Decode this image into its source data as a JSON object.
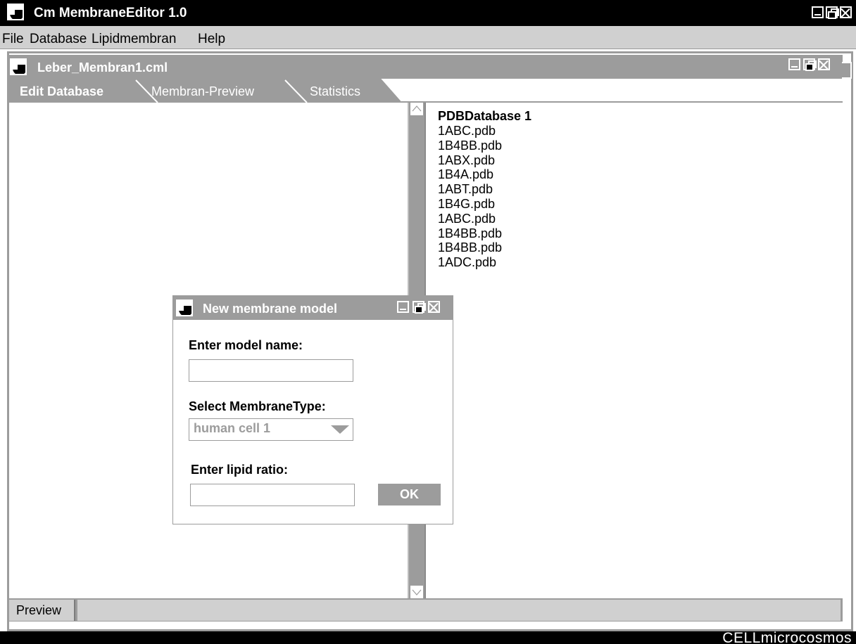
{
  "window": {
    "title": "Cm MembraneEditor 1.0"
  },
  "menu": {
    "items": [
      "File",
      "Database",
      "Lipidmembran",
      "Help"
    ]
  },
  "document": {
    "title": "Leber_Membran1.cml",
    "tabs": [
      {
        "label": "Edit Database",
        "active": true
      },
      {
        "label": "Membran-Preview",
        "active": false
      },
      {
        "label": "Statistics",
        "active": false
      }
    ]
  },
  "database": {
    "title": "PDBDatabase 1",
    "files": [
      "1ABC.pdb",
      "1B4BB.pdb",
      "1ABX.pdb",
      "1B4A.pdb",
      "1ABT.pdb",
      "1B4G.pdb",
      "1ABC.pdb",
      "1B4BB.pdb",
      "1B4BB.pdb",
      "1ADC.pdb"
    ]
  },
  "status": {
    "tab": "Preview"
  },
  "dialog": {
    "title": "New membrane model",
    "model_name_label": "Enter model name:",
    "model_name_value": "",
    "membrane_type_label": "Select MembraneType:",
    "membrane_type_value": "human cell 1",
    "lipid_ratio_label": "Enter lipid ratio:",
    "lipid_ratio_value": "",
    "ok_label": "OK"
  },
  "branding": {
    "logo": "CELLmicrocosmos"
  },
  "colors": {
    "titlebar": "#000000",
    "frame": "#9c9c9c",
    "menubar": "#d0d0d0",
    "disabled_text": "#9c9c9c"
  }
}
